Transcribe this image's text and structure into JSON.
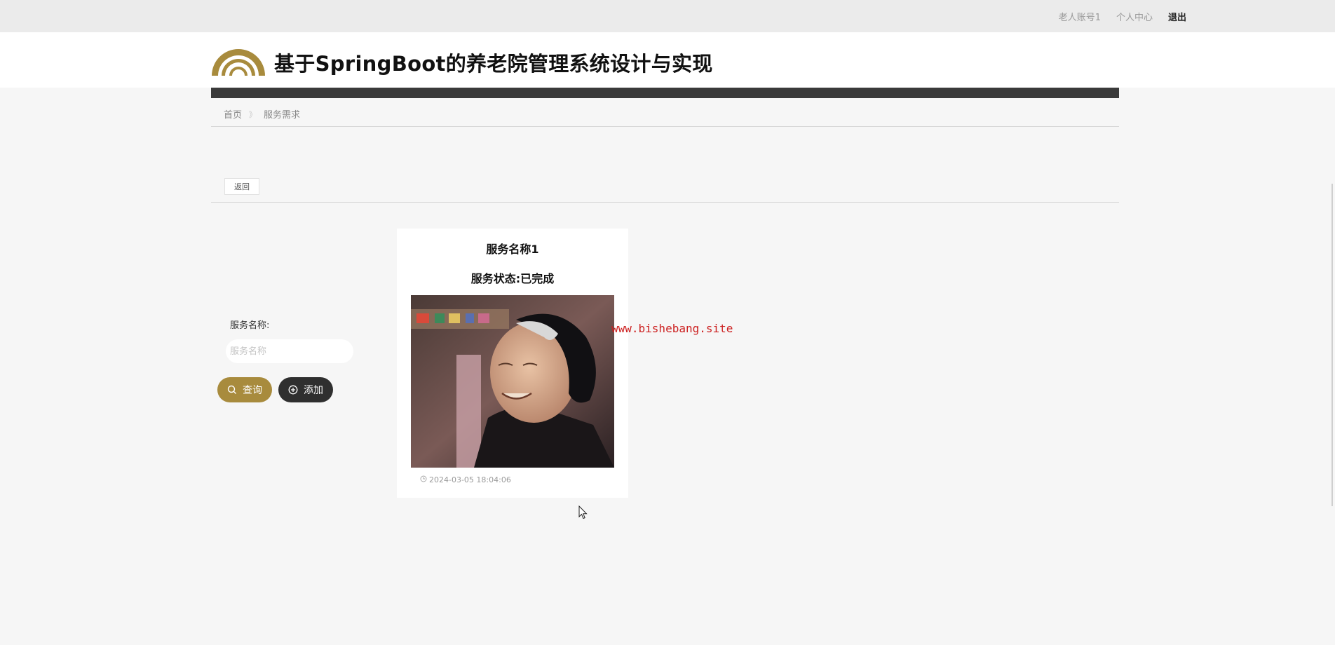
{
  "topbar": {
    "account": "老人账号1",
    "profile": "个人中心",
    "logout": "退出"
  },
  "header": {
    "title": "基于SpringBoot的养老院管理系统设计与实现",
    "logo_icon": "arch-logo-icon",
    "logo_color": "#a88b3d"
  },
  "breadcrumb": {
    "home": "首页",
    "separator": "》",
    "current": "服务需求"
  },
  "back_button": "返回",
  "search": {
    "label": "服务名称:",
    "placeholder": "服务名称",
    "value": "",
    "query_button": "查询",
    "add_button": "添加"
  },
  "card": {
    "title": "服务名称1",
    "status": "服务状态:已完成",
    "timestamp": "2024-03-05 18:04:06"
  },
  "watermark": "www.bishebang.site",
  "colors": {
    "accent": "#a88b3d",
    "dark": "#2f2f2f",
    "watermark": "#cc1f1f"
  }
}
